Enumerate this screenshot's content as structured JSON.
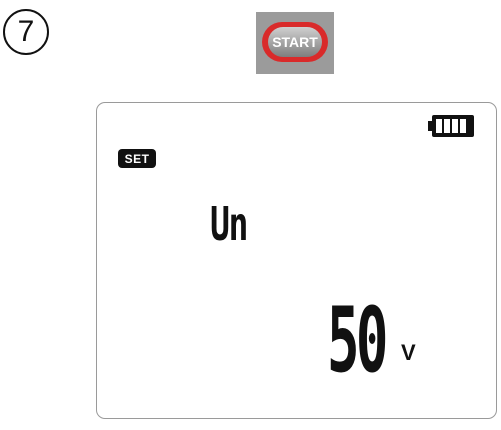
{
  "step": {
    "number": "7"
  },
  "start_button": {
    "label": "START",
    "ring_color": "#d92a2a"
  },
  "display": {
    "battery_icon": "battery-full-icon",
    "mode_badge": "SET",
    "parameter": "Un",
    "value": "50",
    "unit": "V"
  }
}
